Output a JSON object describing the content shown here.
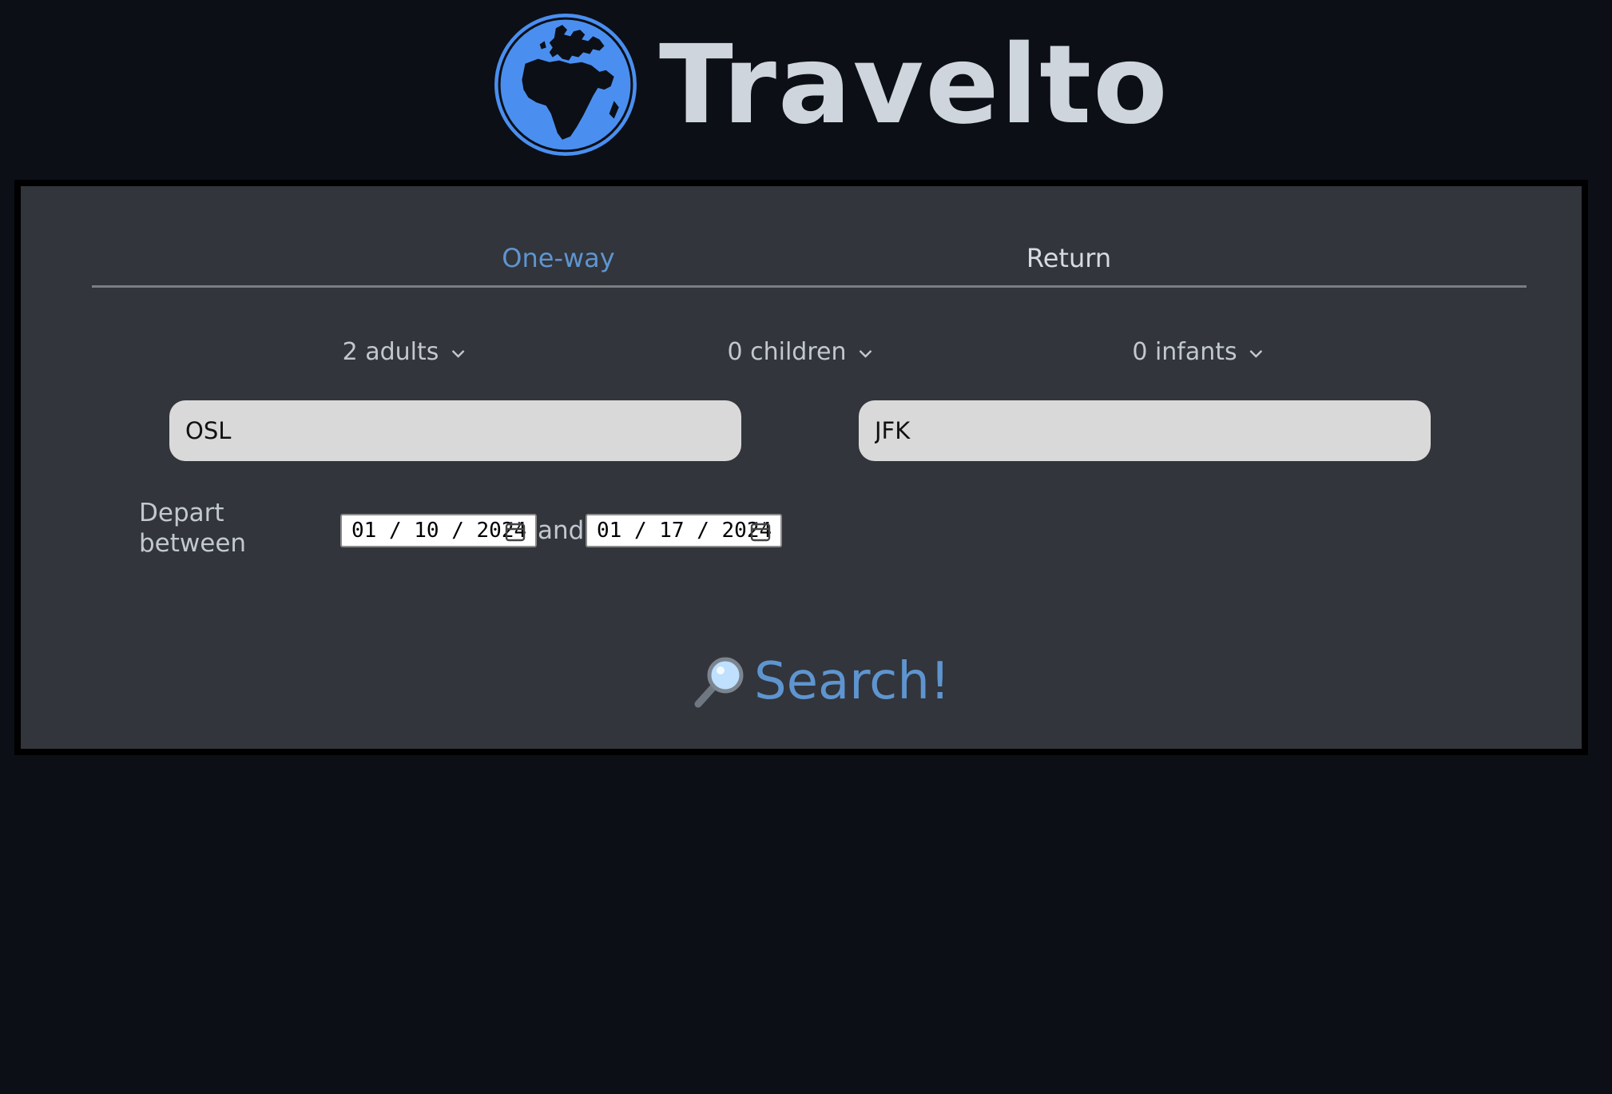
{
  "header": {
    "brand": "Travelto",
    "logo_icon": "globe-icon"
  },
  "trip_tabs": [
    {
      "label": "One-way",
      "active": true
    },
    {
      "label": "Return",
      "active": false
    }
  ],
  "passengers": {
    "adults": "2 adults",
    "children": "0 children",
    "infants": "0 infants"
  },
  "route": {
    "from_value": "OSL",
    "to_value": "JFK"
  },
  "dates": {
    "label": "Depart between",
    "from_value": "01 / 10 / 2024",
    "joiner": "and",
    "to_value": "01 / 17 / 2024"
  },
  "search": {
    "label": "Search!",
    "icon": "magnifier-icon"
  },
  "colors": {
    "background": "#0c0f16",
    "panel": "#32353b",
    "accent": "#5e95d0",
    "globe": "#4a8ff0"
  }
}
